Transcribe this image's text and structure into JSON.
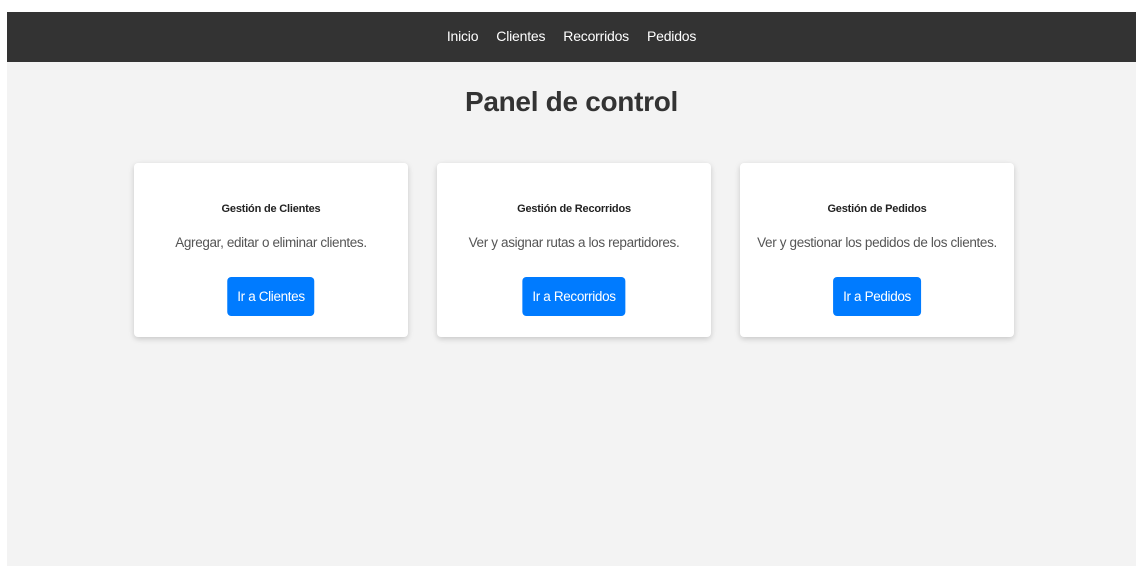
{
  "nav": {
    "items": [
      {
        "label": "Inicio"
      },
      {
        "label": "Clientes"
      },
      {
        "label": "Recorridos"
      },
      {
        "label": "Pedidos"
      }
    ]
  },
  "page": {
    "title": "Panel de control"
  },
  "cards": [
    {
      "title": "Gestión de Clientes",
      "description": "Agregar, editar o eliminar clientes.",
      "button_label": "Ir a Clientes"
    },
    {
      "title": "Gestión de Recorridos",
      "description": "Ver y asignar rutas a los repartidores.",
      "button_label": "Ir a Recorridos"
    },
    {
      "title": "Gestión de Pedidos",
      "description": "Ver y gestionar los pedidos de los clientes.",
      "button_label": "Ir a Pedidos"
    }
  ],
  "colors": {
    "navbar_bg": "#333333",
    "page_bg": "#f3f3f3",
    "card_bg": "#ffffff",
    "accent": "#007bff"
  }
}
